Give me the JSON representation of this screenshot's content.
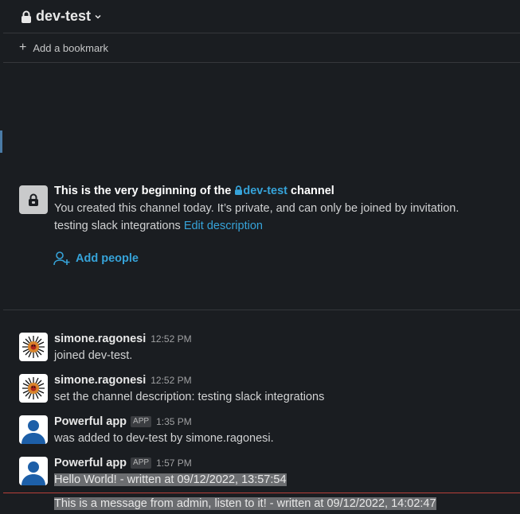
{
  "header": {
    "channel_name": "dev-test"
  },
  "bookmarks": {
    "add_label": "Add a bookmark"
  },
  "intro": {
    "heading_prefix": "This is the very beginning of the",
    "heading_channel": "dev-test",
    "heading_suffix": "channel",
    "line1": "You created this channel today. It’s private, and can only be joined by invitation.",
    "description": "testing slack integrations",
    "edit_link": "Edit description",
    "add_people": "Add people"
  },
  "messages": [
    {
      "author": "simone.ragonesi",
      "time": "12:52 PM",
      "text": "joined dev-test.",
      "is_app": false
    },
    {
      "author": "simone.ragonesi",
      "time": "12:52 PM",
      "text": "set the channel description: testing slack integrations",
      "is_app": false
    },
    {
      "author": "Powerful app",
      "badge": "APP",
      "time": "1:35 PM",
      "text": "was added to dev-test by simone.ragonesi.",
      "is_app": true
    },
    {
      "author": "Powerful app",
      "badge": "APP",
      "time": "1:57 PM",
      "text": "Hello World! - written at 09/12/2022, 13:57:54",
      "is_app": true
    }
  ],
  "continuation": {
    "text": "This is a message from admin, listen to it! - written at 09/12/2022, 14:02:47"
  },
  "colors": {
    "link": "#36a3d9",
    "new_divider": "#b8403a",
    "background": "#1a1d21"
  }
}
